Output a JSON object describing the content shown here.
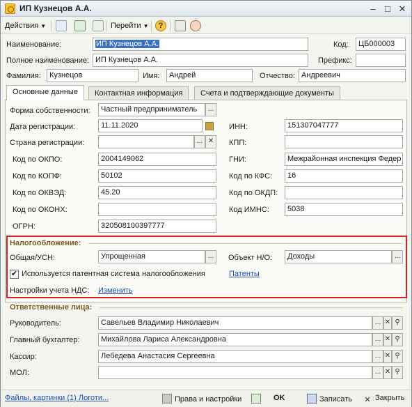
{
  "window": {
    "title": "ИП Кузнецов А.А.",
    "minimize_icon": "minimize-icon",
    "maximize_icon": "maximize-icon",
    "close_icon": "close-icon"
  },
  "toolbar": {
    "actions_label": "Действия",
    "goto_label": "Перейти",
    "help_label": "?"
  },
  "header": {
    "name_label": "Наименование:",
    "name_value": "ИП Кузнецов А.А.",
    "code_label": "Код:",
    "code_value": "ЦБ000003",
    "fullname_label": "Полное наименование:",
    "fullname_value": "ИП Кузнецов А.А.",
    "prefix_label": "Префикс:",
    "prefix_value": "",
    "lastname_label": "Фамилия:",
    "lastname_value": "Кузнецов",
    "firstname_label": "Имя:",
    "firstname_value": "Андрей",
    "middlename_label": "Отчество:",
    "middlename_value": "Андреевич"
  },
  "tabs": [
    {
      "label": "Основные данные",
      "active": true
    },
    {
      "label": "Контактная информация",
      "active": false
    },
    {
      "label": "Счета и подтверждающие документы",
      "active": false
    }
  ],
  "main": {
    "ownership_label": "Форма собственности:",
    "ownership_value": "Частный предприниматель",
    "regdate_label": "Дата регистрации:",
    "regdate_value": "11.11.2020",
    "country_label": "Страна регистрации:",
    "country_value": "",
    "okpo_label": "Код по ОКПО:",
    "okpo_value": "2004149062",
    "kopf_label": "Код по КОПФ:",
    "kopf_value": "50102",
    "okved_label": "Код по ОКВЭД:",
    "okved_value": "45.20",
    "okonh_label": "Код по ОКОНХ:",
    "okonh_value": "",
    "ogrn_label": "ОГРН:",
    "ogrn_value": "320508100397777",
    "inn_label": "ИНН:",
    "inn_value": "151307047777",
    "kpp_label": "КПП:",
    "kpp_value": "",
    "gni_label": "ГНИ:",
    "gni_value": "Межрайонная инспекция Федер",
    "kfs_label": "Код по КФС:",
    "kfs_value": "16",
    "okdp_label": "Код по ОКДП:",
    "okdp_value": "",
    "imns_label": "Код ИМНС:",
    "imns_value": "5038"
  },
  "tax": {
    "group_title": "Налогообложение:",
    "regime_label": "Общая/УСН:",
    "regime_value": "Упрощенная",
    "object_label": "Объект Н/О:",
    "object_value": "Доходы",
    "patent_checkbox_label": "Используется патентная система налогообложения",
    "patent_checked": "✔",
    "patents_link": "Патенты",
    "vat_label": "Настройки учета НДС:",
    "vat_link": "Изменить"
  },
  "responsible": {
    "group_title": "Ответственные лица:",
    "head_label": "Руководитель:",
    "head_value": "Савельев Владимир Николаевич",
    "accountant_label": "Главный бухгалтер:",
    "accountant_value": "Михайлова Лариса Александровна",
    "cashier_label": "Кассир:",
    "cashier_value": "Лебедева Анастасия Сергеевна",
    "mol_label": "МОЛ:",
    "mol_value": ""
  },
  "bottombar": {
    "files_link": "Файлы, картинки (1) Логоти...",
    "rights_label": "Права и настройки",
    "ok_label": "OK",
    "save_label": "Записать",
    "close_label": "Закрыть"
  },
  "colors": {
    "accent_link": "#1c4fb5",
    "group_title": "#7a5a1f",
    "highlight_border": "#e01b1b",
    "selection": "#3b71c2"
  }
}
